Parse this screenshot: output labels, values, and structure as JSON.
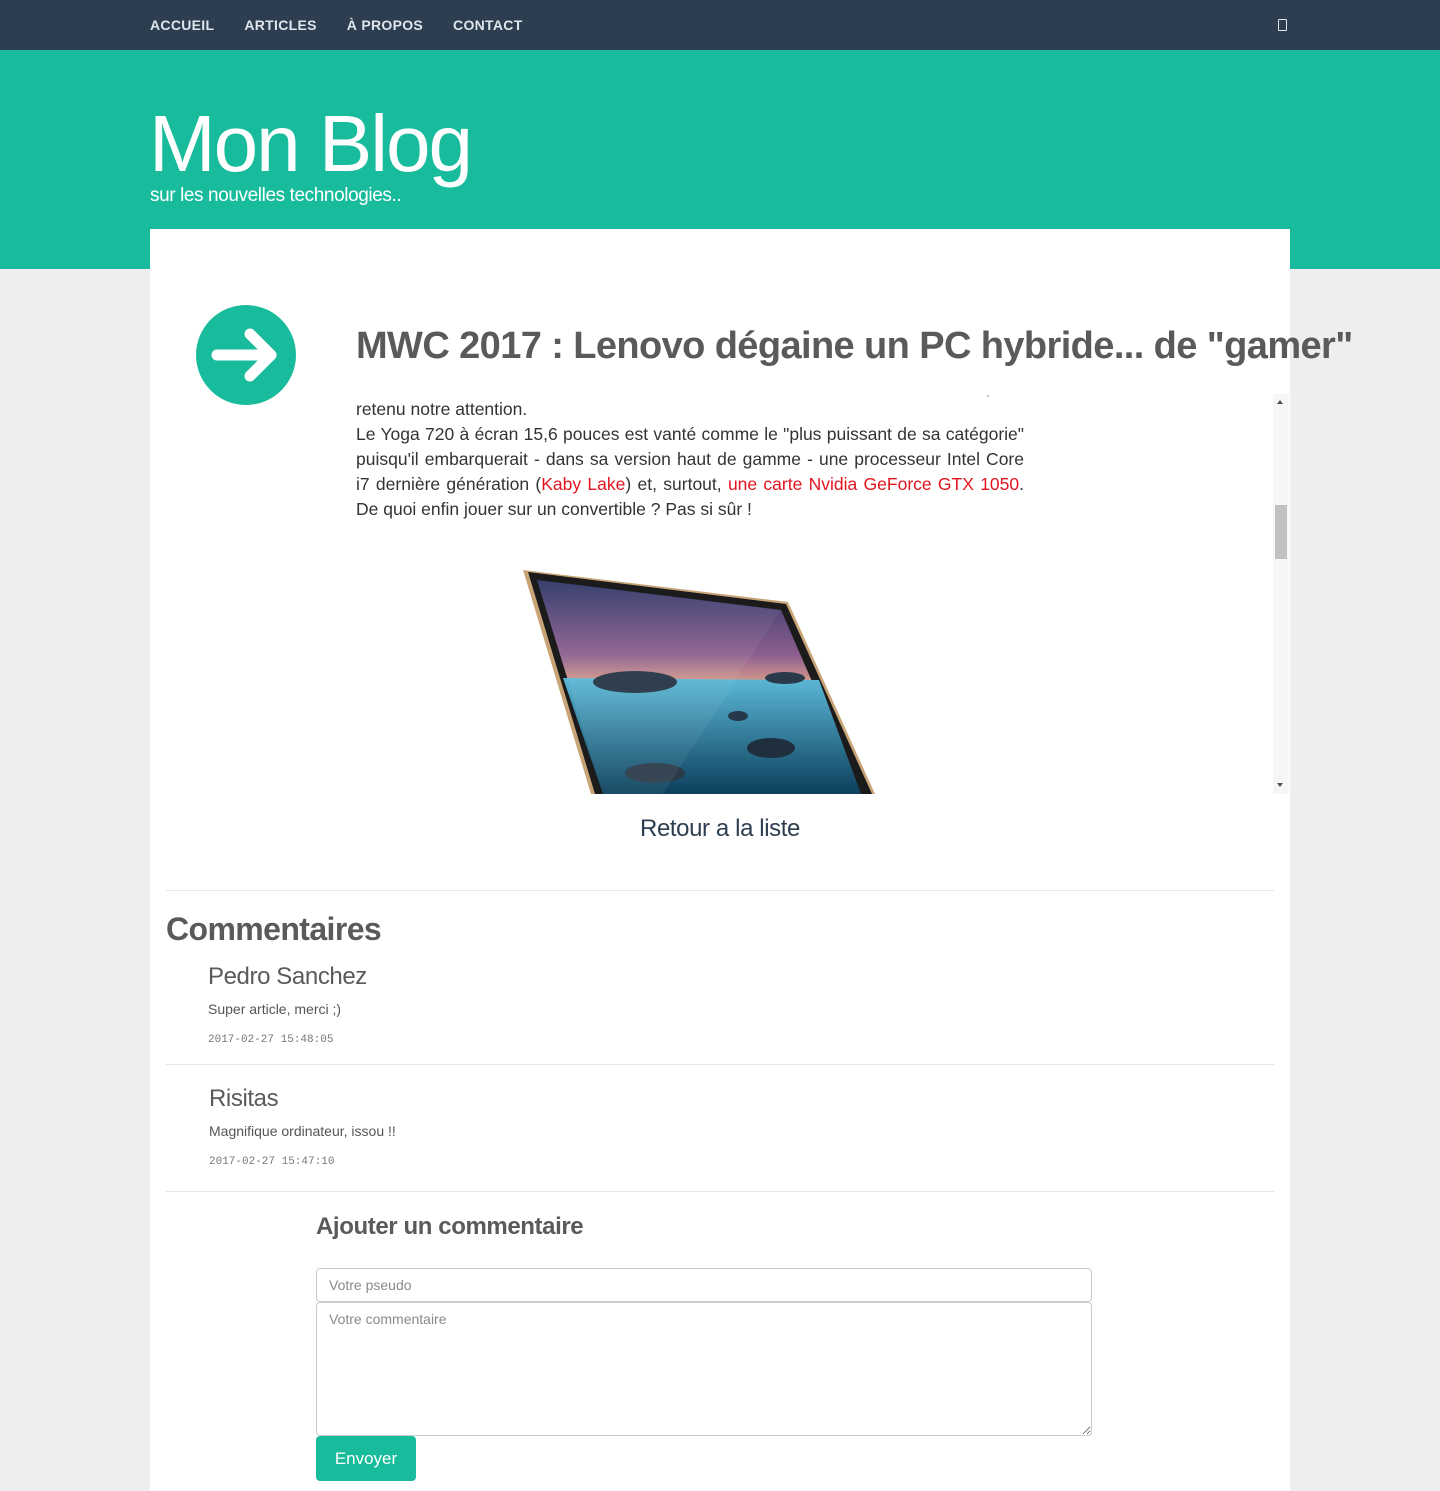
{
  "nav": {
    "items": [
      {
        "label": "ACCUEIL"
      },
      {
        "label": "ARTICLES"
      },
      {
        "label": "À PROPOS"
      },
      {
        "label": "CONTACT"
      }
    ],
    "search_icon": "search-icon"
  },
  "header": {
    "title": "Mon Blog",
    "subtitle": "sur les nouvelles technologies.."
  },
  "post": {
    "icon": "arrow-right-icon",
    "title": "MWC 2017 : Lenovo dégaine un PC hybride... de \"gamer\"",
    "stray": "·",
    "para1": "retenu notre attention.",
    "para2_a": "Le Yoga 720 à écran 15,6 pouces est vanté comme le \"plus puissant de sa catégorie\" puisqu'il embarquerait - dans sa version haut de gamme - une processeur Intel Core i7 dernière génération (",
    "link1": "Kaby Lake",
    "para2_b": ") et, surtout, ",
    "link2": "une carte Nvidia GeForce GTX 1050",
    "para2_c": ". De quoi enfin jouer sur un convertible ? Pas si sûr !",
    "image": "lenovo-yoga-720-laptop",
    "back_label": "Retour a la liste"
  },
  "comments": {
    "heading": "Commentaires",
    "items": [
      {
        "author": "Pedro Sanchez",
        "text": "Super article, merci ;)",
        "date": "2017-02-27 15:48:05"
      },
      {
        "author": "Risitas",
        "text": "Magnifique ordinateur, issou !!",
        "date": "2017-02-27 15:47:10"
      }
    ]
  },
  "form": {
    "heading": "Ajouter un commentaire",
    "pseudo_placeholder": "Votre pseudo",
    "comment_placeholder": "Votre commentaire",
    "submit_label": "Envoyer"
  },
  "colors": {
    "navbar": "#2c3e50",
    "accent": "#18bc9c",
    "link": "#e3141e",
    "background": "#eeeeee"
  }
}
